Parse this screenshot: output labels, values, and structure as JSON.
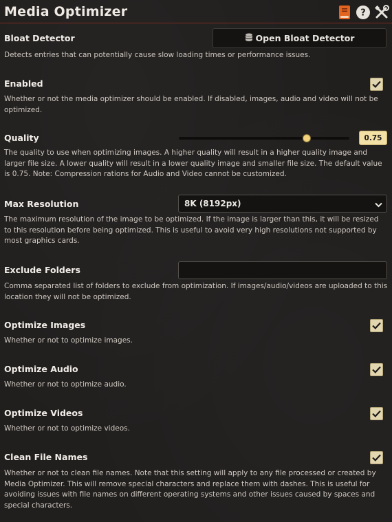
{
  "header": {
    "title": "Media Optimizer"
  },
  "bloat": {
    "label": "Bloat Detector",
    "button_label": "Open Bloat Detector",
    "description": "Detects entries that can potentially cause slow loading times or performance issues."
  },
  "enabled": {
    "label": "Enabled",
    "checked": true,
    "description": "Whether or not the media optimizer should be enabled. If disabled, images, audio and video will not be optimized."
  },
  "quality": {
    "label": "Quality",
    "value": 0.75,
    "value_text": "0.75",
    "description": "The quality to use when optimizing images. A higher quality will result in a higher quality image and larger file size. A lower quality will result in a lower quality image and smaller file size. The default value is 0.75. Note: Compression rations for Audio and Video cannot be customized."
  },
  "max_resolution": {
    "label": "Max Resolution",
    "selected": "8K (8192px)",
    "description": "The maximum resolution of the image to be optimized. If the image is larger than this, it will be resized to this resolution before being optimized. This is useful to avoid very high resolutions not supported by most graphics cards."
  },
  "exclude_folders": {
    "label": "Exclude Folders",
    "value": "",
    "placeholder": "",
    "description": "Comma separated list of folders to exclude from optimization. If images/audio/videos are uploaded to this location they will not be optimized."
  },
  "optimize_images": {
    "label": "Optimize Images",
    "checked": true,
    "description": "Whether or not to optimize images."
  },
  "optimize_audio": {
    "label": "Optimize Audio",
    "checked": true,
    "description": "Whether or not to optimize audio."
  },
  "optimize_videos": {
    "label": "Optimize Videos",
    "checked": true,
    "description": "Whether or not to optimize videos."
  },
  "clean_file_names": {
    "label": "Clean File Names",
    "checked": true,
    "description": "Whether or not to clean file names. Note that this setting will apply to any file processed or created by Media Optimizer. This will remove special characters and replace them with dashes. This is useful for avoiding issues with file names on different operating systems and other issues caused by spaces and special characters."
  },
  "icons": [
    "book-icon",
    "help-icon",
    "tools-icon",
    "database-icon",
    "check-icon",
    "chevron-down-icon"
  ],
  "colors": {
    "accent": "#e2d6b0",
    "book": "#e3641f",
    "divider": "#7a2a1f"
  }
}
